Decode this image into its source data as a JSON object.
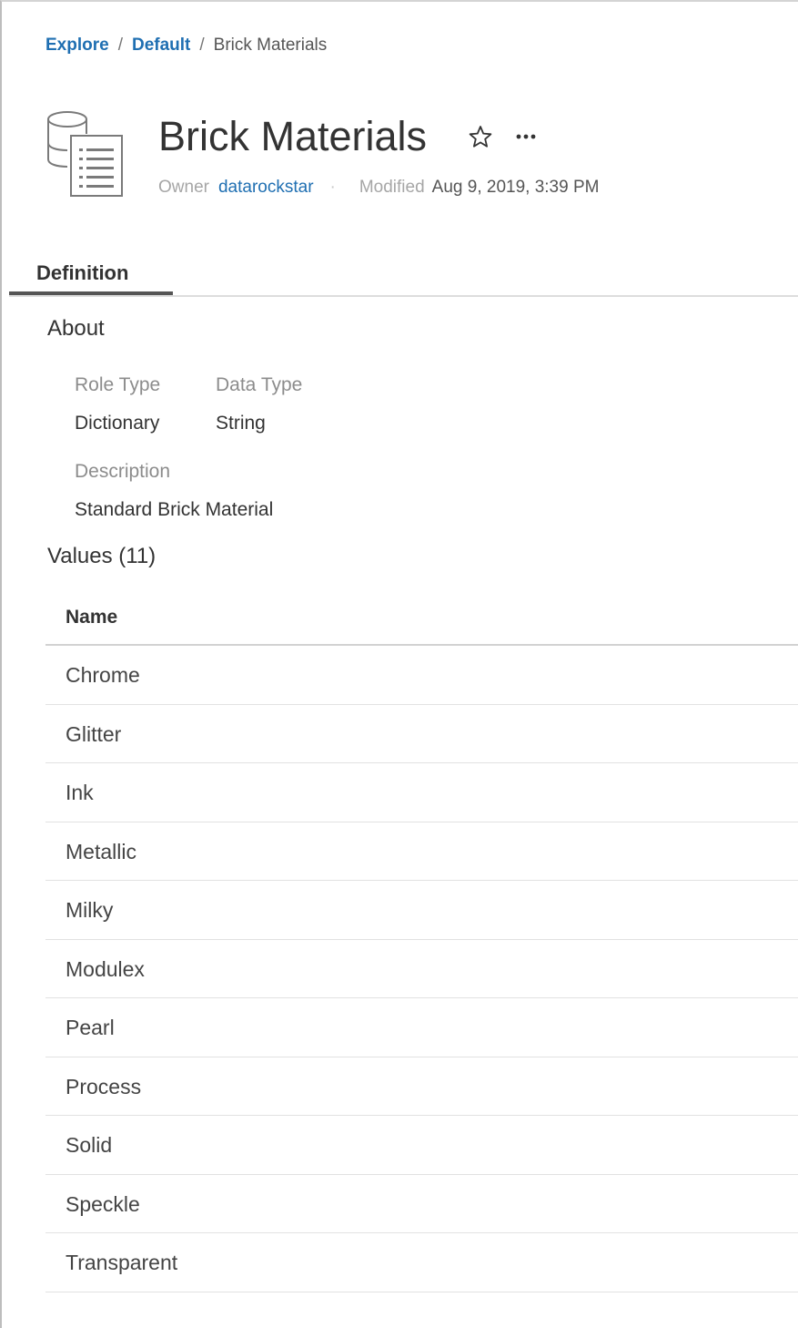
{
  "breadcrumb": {
    "items": [
      {
        "label": "Explore"
      },
      {
        "label": "Default"
      }
    ],
    "separator": "/",
    "current": "Brick Materials"
  },
  "header": {
    "title": "Brick Materials",
    "owner_label": "Owner",
    "owner": "datarockstar",
    "meta_separator": "·",
    "modified_label": "Modified",
    "modified": "Aug 9, 2019, 3:39 PM"
  },
  "tabs": [
    {
      "label": "Definition",
      "active": true
    }
  ],
  "about": {
    "heading": "About",
    "role_type_label": "Role Type",
    "role_type": "Dictionary",
    "data_type_label": "Data Type",
    "data_type": "String",
    "description_label": "Description",
    "description": "Standard Brick Material"
  },
  "values": {
    "heading": "Values (11)",
    "column_header": "Name",
    "rows": [
      "Chrome",
      "Glitter",
      "Ink",
      "Metallic",
      "Milky",
      "Modulex",
      "Pearl",
      "Process",
      "Solid",
      "Speckle",
      "Transparent"
    ]
  },
  "icons": {
    "data_role": "database-document-icon",
    "favorite": "star-outline-icon",
    "more": "more-actions-icon"
  },
  "colors": {
    "link": "#1f6fb2",
    "text": "#333333",
    "muted": "#a6a6a6",
    "tab_underline": "#555555",
    "divider": "#d2d2d2"
  }
}
